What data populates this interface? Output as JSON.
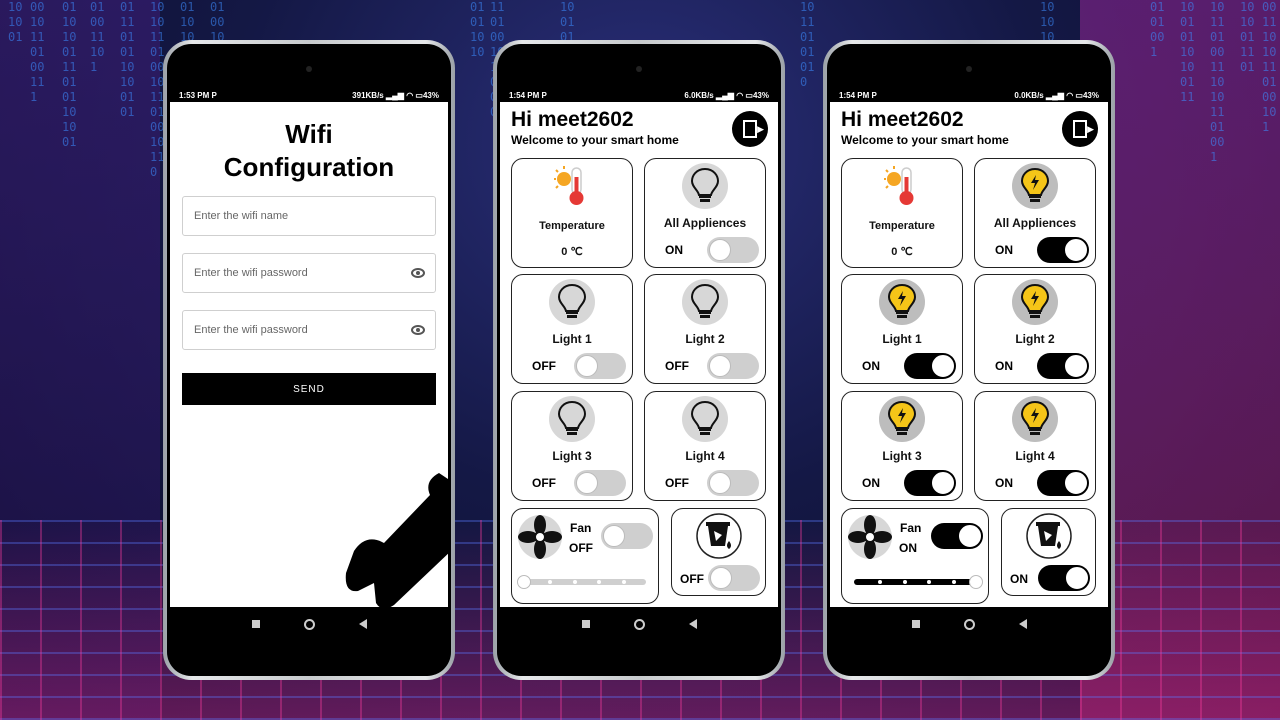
{
  "background": {
    "code_digits": "1010010110100111010110100101101001011010"
  },
  "colors": {
    "accent": "#000000",
    "toggle_off": "#cfcfcf",
    "bulb_on": "#f5c518",
    "temp_red": "#e53935",
    "sun": "#f5a623"
  },
  "phone1": {
    "status": {
      "time": "1:53 PM",
      "speed": "391KB/s",
      "battery": "43%"
    },
    "title_line1": "Wifi",
    "title_line2": "Configuration",
    "wifi_name_placeholder": "Enter the wifi name",
    "wifi_password_placeholder": "Enter the wifi password",
    "wifi_password2_placeholder": "Enter the wifi password",
    "send_label": "SEND"
  },
  "phone2": {
    "status": {
      "time": "1:54 PM",
      "speed": "6.0KB/s",
      "battery": "43%"
    },
    "greeting": "Hi meet2602",
    "subtitle": "Welcome to your smart home",
    "temperature": {
      "label": "Temperature",
      "value": "0 ℃"
    },
    "all_appliances": {
      "label": "All Appliences",
      "state": "ON",
      "on": false
    },
    "light1": {
      "label": "Light 1",
      "state": "OFF",
      "on": false
    },
    "light2": {
      "label": "Light 2",
      "state": "OFF",
      "on": false
    },
    "light3": {
      "label": "Light 3",
      "state": "OFF",
      "on": false
    },
    "light4": {
      "label": "Light 4",
      "state": "OFF",
      "on": false
    },
    "fan": {
      "label": "Fan",
      "state": "OFF",
      "on": false,
      "speed": 0
    },
    "pump": {
      "state": "OFF",
      "on": false
    }
  },
  "phone3": {
    "status": {
      "time": "1:54 PM",
      "speed": "0.0KB/s",
      "battery": "43%"
    },
    "greeting": "Hi meet2602",
    "subtitle": "Welcome to your smart home",
    "temperature": {
      "label": "Temperature",
      "value": "0 ℃"
    },
    "all_appliances": {
      "label": "All Appliences",
      "state": "ON",
      "on": true
    },
    "light1": {
      "label": "Light 1",
      "state": "ON",
      "on": true
    },
    "light2": {
      "label": "Light 2",
      "state": "ON",
      "on": true
    },
    "light3": {
      "label": "Light 3",
      "state": "ON",
      "on": true
    },
    "light4": {
      "label": "Light 4",
      "state": "ON",
      "on": true
    },
    "fan": {
      "label": "Fan",
      "state": "ON",
      "on": true,
      "speed": 1
    },
    "pump": {
      "state": "ON",
      "on": true
    }
  }
}
